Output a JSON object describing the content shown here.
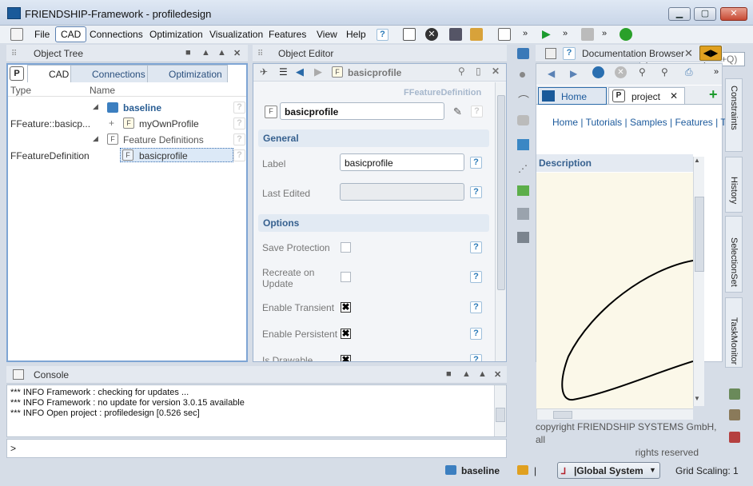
{
  "window": {
    "title": "FRIENDSHIP-Framework - profiledesign",
    "min": "▁",
    "max": "▢",
    "close": "✕"
  },
  "menu": [
    "File",
    "CAD",
    "Connections",
    "Optimization",
    "Visualization",
    "Features",
    "View",
    "Help"
  ],
  "quick_access": {
    "placeholder": "Quick Access (Ctrl+Q)"
  },
  "object_tree": {
    "title": "Object Tree",
    "tabs": [
      "CAD",
      "Connections",
      "Optimization"
    ],
    "col_type": "Type",
    "col_name": "Name",
    "rows": [
      {
        "type": "",
        "name": "baseline"
      },
      {
        "type": "FFeature::basicp...",
        "name": "myOwnProfile"
      },
      {
        "type": "",
        "name": "Feature Definitions"
      },
      {
        "type": "FFeatureDefinition",
        "name": "basicprofile"
      }
    ]
  },
  "object_editor": {
    "title": "Object Editor",
    "object_name": "basicprofile",
    "object_type": "FFeatureDefinition",
    "name_field": "basicprofile",
    "section_general": "General",
    "label_label": "Label",
    "label_value": "basicprofile",
    "last_edited": "Last Edited",
    "section_options": "Options",
    "save_protection": "Save Protection",
    "recreate_line1": "Recreate on",
    "recreate_line2": "Update",
    "enable_transient": "Enable Transient",
    "enable_persistent": "Enable Persistent",
    "is_drawable": "Is Drawable"
  },
  "doc_browser": {
    "title": "Documentation Browser",
    "tab_home": "Home",
    "tab_project": "project",
    "links": [
      "Home",
      "Tutorials",
      "Samples",
      "Features",
      "T"
    ],
    "description": "Description",
    "copyright1": "copyright FRIENDSHIP SYSTEMS GmbH, all",
    "copyright2": "rights reserved"
  },
  "side_tabs": [
    "Constraints",
    "History",
    "SelectionSet",
    "TaskMonitor"
  ],
  "console": {
    "title": "Console",
    "lines": [
      "*** INFO Framework : checking for updates ...",
      "*** INFO Framework : no update for version 3.0.15 available",
      "*** INFO Open project : profiledesign [0.526 sec]"
    ],
    "prompt": ">"
  },
  "status": {
    "object": "baseline",
    "system": "|Global System",
    "grid": "Grid Scaling: 1"
  },
  "colors": {
    "accent": "#2a6aa8",
    "selection": "#dce9f7"
  }
}
